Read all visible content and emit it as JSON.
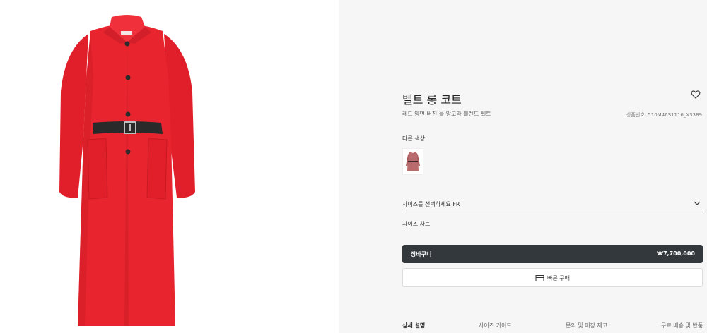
{
  "product": {
    "title": "벨트 롱 코트",
    "subtitle": "레드 양면 버진 울 앙고라 블렌드 펠트",
    "sku": "상품번호: 510M46S1116_X3389",
    "wishlist_icon": "heart-icon"
  },
  "colors": {
    "coat_red": "#e8252f",
    "belt": "#2a2a2a",
    "swatch_coat": "#b96a6c",
    "cart_bg": "#33383c"
  },
  "other_colors": {
    "label": "다른 색상"
  },
  "size": {
    "placeholder": "사이즈를 선택하세요 FR",
    "chart_link": "사이즈 차트"
  },
  "cart": {
    "label": "장바구니",
    "price": "₩7,700,000"
  },
  "quick_buy": {
    "label": "빠른 구매",
    "icon": "card-icon"
  },
  "tabs": [
    {
      "label": "상세 설명",
      "active": true
    },
    {
      "label": "사이즈 가이드",
      "active": false
    },
    {
      "label": "문의 및 매장 재고",
      "active": false
    },
    {
      "label": "무료 배송 및 반품",
      "active": false
    }
  ]
}
